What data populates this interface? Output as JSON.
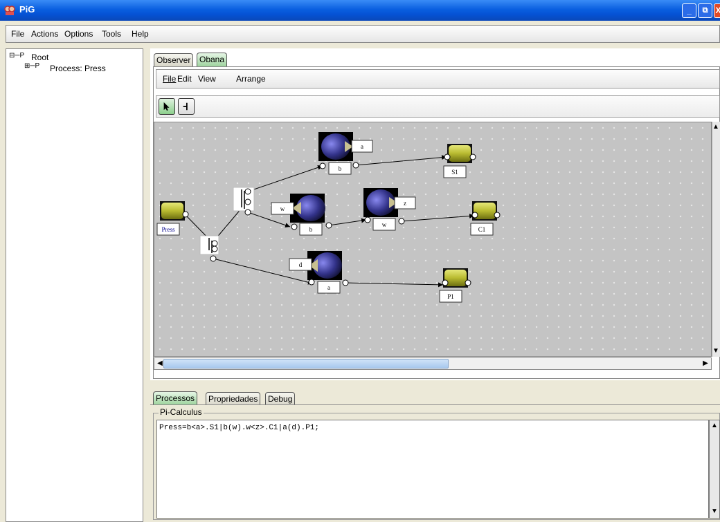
{
  "window": {
    "title": "PiG",
    "controls": [
      "_",
      "⧉",
      "X"
    ]
  },
  "menubar": [
    "File",
    "Actions",
    "Options",
    "Tools",
    "Help"
  ],
  "tree": {
    "root_prefix": "⊟─P",
    "root": "Root",
    "child_prefix": "⊞─P",
    "child": "Process: Press"
  },
  "top_tabs": [
    "Observer",
    "Obana"
  ],
  "editor_menu": [
    "File",
    "Edit",
    "View",
    "Arrange"
  ],
  "tools": [
    "select-arrow",
    "connect-tool"
  ],
  "diagram": {
    "nodes": {
      "press": "Press",
      "s1": "S1",
      "c1": "C1",
      "p1": "P1"
    },
    "channels": {
      "top_out": "a",
      "top_in": "b",
      "mid_in_name": "w",
      "mid_in": "b",
      "mid2_out": "z",
      "mid2_in": "w",
      "bot_in_name": "d",
      "bot_in": "a"
    }
  },
  "bottom_tabs": [
    "Processos",
    "Propriedades",
    "Debug"
  ],
  "pi_calculus": {
    "legend": "Pi-Calculus",
    "expression": "Press=b<a>.S1|b(w).w<z>.C1|a(d).P1;"
  },
  "colors": {
    "titlebar": "#0a5fe0",
    "canvas": "#c4c4c4",
    "active_tab": "#9fd49f"
  }
}
